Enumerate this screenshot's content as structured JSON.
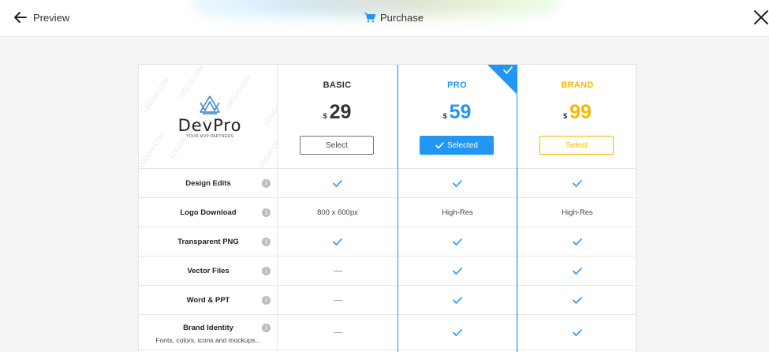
{
  "topbar": {
    "preview_label": "Preview",
    "purchase_label": "Purchase"
  },
  "logo": {
    "name": "DevPro",
    "tagline": "YOUR MVP PARTNERS",
    "watermark": "LOGOAI.COM"
  },
  "plans": [
    {
      "name": "BASIC",
      "currency": "$",
      "price": "29",
      "button": "Select",
      "color": "#333333",
      "selected": false
    },
    {
      "name": "PRO",
      "currency": "$",
      "price": "59",
      "button": "Selected",
      "color": "#2196f3",
      "selected": true
    },
    {
      "name": "BRAND",
      "currency": "$",
      "price": "99",
      "button": "Select",
      "color": "#f5b800",
      "selected": false
    }
  ],
  "features": [
    {
      "label": "Design Edits",
      "values": [
        "check",
        "check",
        "check"
      ]
    },
    {
      "label": "Logo Download",
      "values": [
        "800 x 600px",
        "High-Res",
        "High-Res"
      ]
    },
    {
      "label": "Transparent PNG",
      "values": [
        "check",
        "check",
        "check"
      ]
    },
    {
      "label": "Vector Files",
      "values": [
        "dash",
        "check",
        "check"
      ]
    },
    {
      "label": "Word & PPT",
      "values": [
        "dash",
        "check",
        "check"
      ]
    },
    {
      "label": "Brand Identity",
      "sub": "Fonts, colors, icons and mockups...",
      "values": [
        "dash",
        "check",
        "check"
      ]
    }
  ],
  "icons": {
    "back": "arrow-left-icon",
    "cart": "cart-icon",
    "close": "close-icon",
    "info": "info-icon",
    "check": "check-icon",
    "dash": "dash-icon"
  },
  "colors": {
    "accent": "#2196f3",
    "brand": "#f5b800"
  }
}
